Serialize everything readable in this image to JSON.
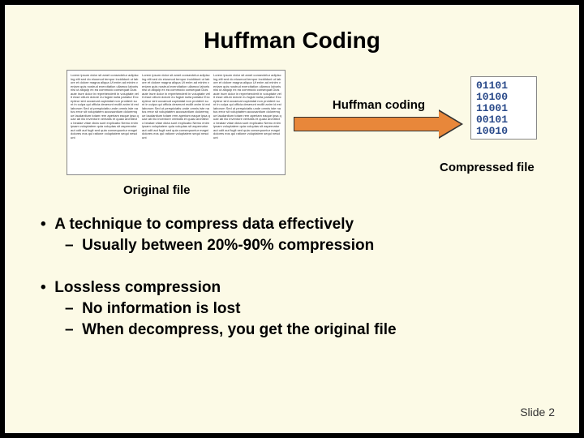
{
  "title": "Huffman Coding",
  "diagram": {
    "arrow_label": "Huffman coding",
    "original_label": "Original file",
    "compressed_label": "Compressed file",
    "compressed_lines": [
      "01101",
      "10100",
      "11001",
      "00101",
      "10010"
    ],
    "filler": "Lorem ipsum dolor sit amet consectetur adipiscing elit sed do eiusmod tempor incididunt ut labore et dolore magna aliqua Ut enim ad minim veniam quis nostrud exercitation ullamco laboris nisi ut aliquip ex ea commodo consequat Duis aute irure dolor in reprehenderit in voluptate velit esse cillum dolore eu fugiat nulla pariatur Excepteur sint occaecat cupidatat non proident sunt in culpa qui officia deserunt mollit anim id est laborum Sed ut perspiciatis unde omnis iste natus error sit voluptatem accusantium doloremque laudantium totam rem aperiam eaque ipsa quae ab illo inventore veritatis et quasi architecto beatae vitae dicta sunt explicabo Nemo enim ipsam voluptatem quia voluptas sit aspernatur aut odit aut fugit sed quia consequuntur magni dolores eos qui ratione voluptatem sequi nesciunt"
  },
  "bullets": [
    {
      "text": "A technique to compress data effectively",
      "sub": [
        "Usually between 20%-90% compression"
      ]
    },
    {
      "text": "Lossless compression",
      "sub": [
        "No information is lost",
        "When decompress, you get the original file"
      ]
    }
  ],
  "footer": "Slide 2"
}
